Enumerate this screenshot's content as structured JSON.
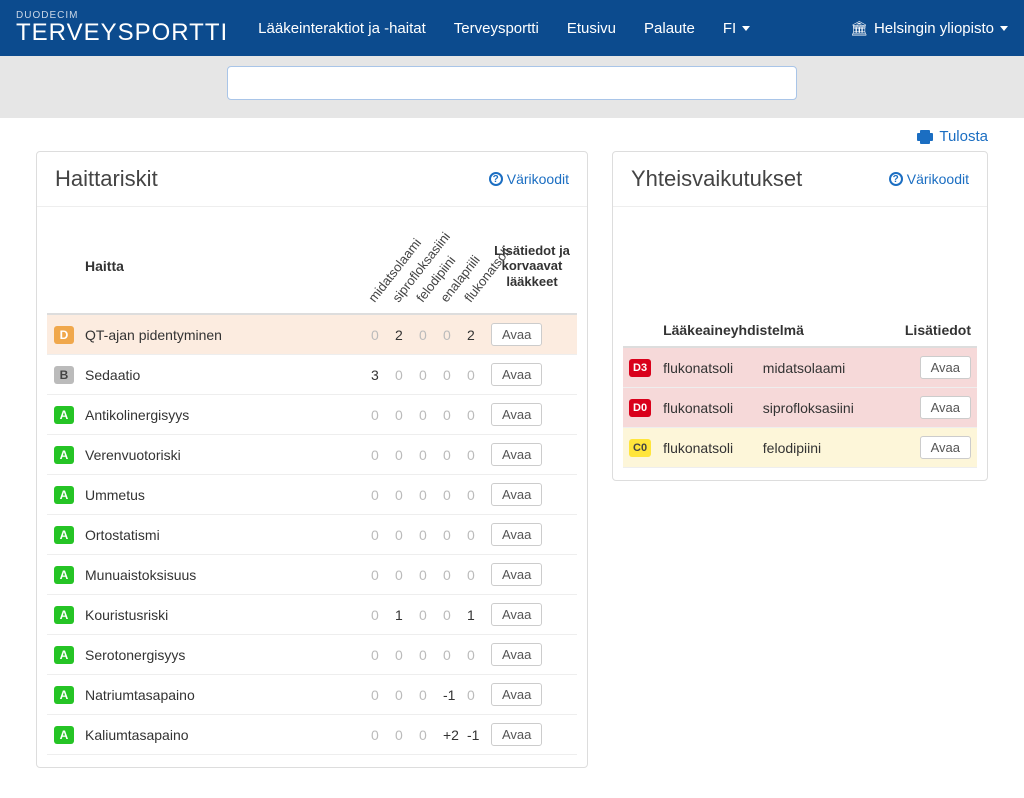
{
  "nav": {
    "brand_small": "DUODECIM",
    "brand_large": "TERVEYSPORTTI",
    "links": [
      "Lääkeinteraktiot ja -haitat",
      "Terveysportti",
      "Etusivu",
      "Palaute"
    ],
    "lang": "FI",
    "institution": "Helsingin yliopisto"
  },
  "print": "Tulosta",
  "left": {
    "title": "Haittariskit",
    "color_codes": "Värikoodit",
    "columns": {
      "harm": "Haitta",
      "info": "Lisätiedot ja\nkorvaavat\nlääkkeet"
    },
    "drugs": [
      "midatsolaami",
      "siprofloksasiini",
      "felodipiini",
      "enalapriili",
      "flukonatsoli"
    ],
    "rows": [
      {
        "badge": "D",
        "name": "QT-ajan pidentyminen",
        "vals": [
          "0",
          "2",
          "0",
          "0",
          "2"
        ]
      },
      {
        "badge": "B",
        "name": "Sedaatio",
        "vals": [
          "3",
          "0",
          "0",
          "0",
          "0"
        ]
      },
      {
        "badge": "A",
        "name": "Antikolinergisyys",
        "vals": [
          "0",
          "0",
          "0",
          "0",
          "0"
        ]
      },
      {
        "badge": "A",
        "name": "Verenvuotoriski",
        "vals": [
          "0",
          "0",
          "0",
          "0",
          "0"
        ]
      },
      {
        "badge": "A",
        "name": "Ummetus",
        "vals": [
          "0",
          "0",
          "0",
          "0",
          "0"
        ]
      },
      {
        "badge": "A",
        "name": "Ortostatismi",
        "vals": [
          "0",
          "0",
          "0",
          "0",
          "0"
        ]
      },
      {
        "badge": "A",
        "name": "Munuaistoksisuus",
        "vals": [
          "0",
          "0",
          "0",
          "0",
          "0"
        ]
      },
      {
        "badge": "A",
        "name": "Kouristusriski",
        "vals": [
          "0",
          "1",
          "0",
          "0",
          "1"
        ]
      },
      {
        "badge": "A",
        "name": "Serotonergisyys",
        "vals": [
          "0",
          "0",
          "0",
          "0",
          "0"
        ]
      },
      {
        "badge": "A",
        "name": "Natriumtasapaino",
        "vals": [
          "0",
          "0",
          "0",
          "-1",
          "0"
        ]
      },
      {
        "badge": "A",
        "name": "Kaliumtasapaino",
        "vals": [
          "0",
          "0",
          "0",
          "+2",
          "-1"
        ]
      }
    ],
    "open": "Avaa"
  },
  "right": {
    "title": "Yhteisvaikutukset",
    "color_codes": "Värikoodit",
    "columns": {
      "combo": "Lääkeaineyhdistelmä",
      "info": "Lisätiedot"
    },
    "rows": [
      {
        "badge": "D3",
        "drug1": "flukonatsoli",
        "drug2": "midatsolaami"
      },
      {
        "badge": "D0",
        "drug1": "flukonatsoli",
        "drug2": "siprofloksasiini"
      },
      {
        "badge": "C0",
        "drug1": "flukonatsoli",
        "drug2": "felodipiini"
      }
    ],
    "open": "Avaa"
  }
}
